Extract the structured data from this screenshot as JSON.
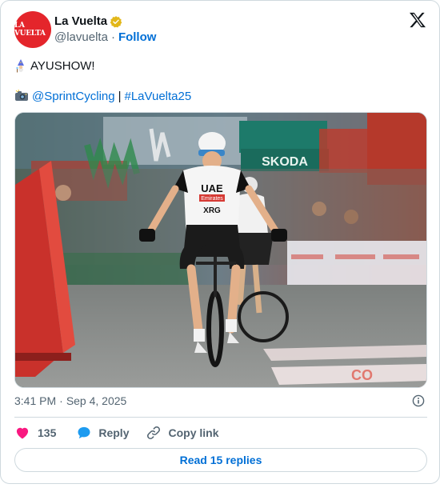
{
  "author": {
    "name": "La Vuelta",
    "handle": "@lavuelta",
    "follow_label": "Follow",
    "avatar_text": "LA VUELTA",
    "verified": true
  },
  "post": {
    "line1_text": "AYUSHOW!",
    "line1_emoji": "wizard-emoji",
    "line2_emoji": "camera-emoji",
    "mention": "@SprintCycling",
    "separator": "|",
    "hashtag": "#LaVuelta25",
    "image_alt": "Cyclist in UAE XRG kit celebrating at the finish line"
  },
  "photo_text": {
    "jersey_line1": "UAE",
    "jersey_line2": "Emirates",
    "jersey_line3": "XRG",
    "banner": "SKODA"
  },
  "meta": {
    "time": "3:41 PM",
    "date": "Sep 4, 2025"
  },
  "actions": {
    "like_count": "135",
    "reply_label": "Reply",
    "copy_label": "Copy link"
  },
  "read_replies_label": "Read 15 replies",
  "colors": {
    "brand_red": "#e4252b",
    "link_blue": "#006fd6",
    "like_pink": "#f91880",
    "reply_blue": "#1d9bf0",
    "verified_gold": "#e2b719"
  }
}
